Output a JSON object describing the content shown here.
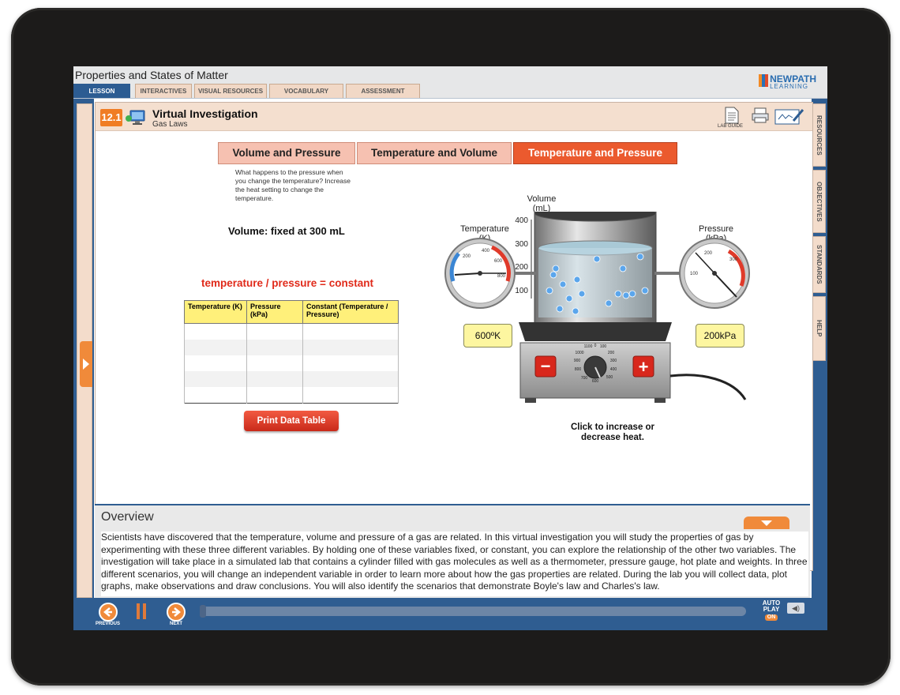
{
  "app_title": "Properties and States of Matter",
  "tabs": [
    "LESSON",
    "INTERACTIVES",
    "VISUAL RESOURCES",
    "VOCABULARY",
    "ASSESSMENT"
  ],
  "logo": {
    "main": "NEWPATH",
    "sub": "LEARNING"
  },
  "side_tabs": [
    "RESOURCES",
    "OBJECTIVES",
    "STANDARDS",
    "HELP"
  ],
  "lesson": {
    "number": "12.1",
    "title": "Virtual Investigation",
    "subtitle": "Gas Laws"
  },
  "toolbar": {
    "lab_guide_label": "LAB GUIDE"
  },
  "experiment_tabs": [
    "Volume and Pressure",
    "Temperature and Volume",
    "Temperature and Pressure"
  ],
  "active_experiment": "Temperature and Pressure",
  "question": "What happens to the pressure when you change the temperature? Increase the heat setting to change the temperature.",
  "fixed_label": "Volume: fixed at 300 mL",
  "formula": "temperature / pressure = constant",
  "data_table": {
    "headers": [
      "Temperature (K)",
      "Pressure (kPa)",
      "Constant (Temperature / Pressure)"
    ],
    "rows": [
      [
        "",
        "",
        ""
      ],
      [
        "",
        "",
        ""
      ],
      [
        "",
        "",
        ""
      ],
      [
        "",
        "",
        ""
      ],
      [
        "",
        "",
        ""
      ]
    ]
  },
  "print_button": "Print Data Table",
  "apparatus": {
    "volume_label": "Volume\n(mL)",
    "volume_ticks": [
      "400",
      "300",
      "200",
      "100"
    ],
    "temperature_label": "Temperature\n(K)",
    "pressure_label": "Pressure\n(kPa)",
    "temp_gauge_ticks": [
      "200",
      "400",
      "600",
      "800"
    ],
    "pressure_gauge_ticks": [
      "100",
      "200",
      "300"
    ],
    "temperature_readout": "600ºK",
    "pressure_readout": "200kPa",
    "dial_ticks": [
      "1100",
      "0",
      "100",
      "200",
      "300",
      "400",
      "500",
      "600",
      "700",
      "800",
      "900",
      "1000"
    ],
    "minus_label": "−",
    "plus_label": "+",
    "caption": "Click to increase or decrease heat."
  },
  "overview": {
    "title": "Overview",
    "text": "Scientists have discovered that the temperature, volume and pressure of a gas are related. In this virtual investigation you will study the properties of gas by experimenting with these three different variables. By holding one of these variables fixed, or constant, you can explore the relationship of the other two variables. The investigation will take place in a simulated lab that contains a cylinder filled with gas molecules as well as a thermometer, pressure gauge, hot plate and weights. In three different scenarios, you will change an independent variable in order to learn more about how the gas properties are related.  During the lab you will collect data, plot graphs, make observations and draw conclusions. You will also identify the scenarios that demonstrate Boyle's law and Charles's law."
  },
  "footer": {
    "previous_label": "PREVIOUS",
    "next_label": "NEXT",
    "autoplay_label": "AUTO PLAY",
    "autoplay_state": "ON",
    "progress": 0.0
  },
  "colors": {
    "accent": "#eb5a2e",
    "nav_blue": "#2f5d91",
    "orange": "#f08a3a",
    "table_header": "#fff07a"
  }
}
